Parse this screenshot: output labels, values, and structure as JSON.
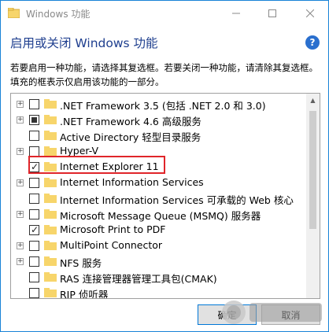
{
  "window": {
    "title": "Windows 功能",
    "heading": "启用或关闭 Windows 功能",
    "description": "若要启用一种功能，请选择其复选框。若要关闭一种功能，请清除其复选框。填充的框表示仅启用该功能的一部分。"
  },
  "features": [
    {
      "label": ".NET Framework 3.5 (包括 .NET 2.0 和 3.0)",
      "expandable": true,
      "state": "unchecked"
    },
    {
      "label": ".NET Framework 4.6 高级服务",
      "expandable": true,
      "state": "partial"
    },
    {
      "label": "Active Directory 轻型目录服务",
      "expandable": false,
      "state": "unchecked"
    },
    {
      "label": "Hyper-V",
      "expandable": true,
      "state": "unchecked"
    },
    {
      "label": "Internet Explorer 11",
      "expandable": false,
      "state": "checked"
    },
    {
      "label": "Internet Information Services",
      "expandable": true,
      "state": "unchecked"
    },
    {
      "label": "Internet Information Services 可承载的 Web 核心",
      "expandable": false,
      "state": "unchecked"
    },
    {
      "label": "Microsoft Message Queue (MSMQ) 服务器",
      "expandable": true,
      "state": "unchecked"
    },
    {
      "label": "Microsoft Print to PDF",
      "expandable": false,
      "state": "checked"
    },
    {
      "label": "MultiPoint Connector",
      "expandable": true,
      "state": "unchecked"
    },
    {
      "label": "NFS 服务",
      "expandable": true,
      "state": "unchecked"
    },
    {
      "label": "RAS 连接管理器管理工具包(CMAK)",
      "expandable": false,
      "state": "unchecked"
    },
    {
      "label": "RIP 侦听器",
      "expandable": false,
      "state": "unchecked"
    }
  ],
  "buttons": {
    "ok": "确定",
    "cancel": "取消"
  },
  "colors": {
    "heading": "#1f3f8f",
    "highlight": "#e0252a",
    "folder": "#f7d56b",
    "accent": "#0078d7"
  }
}
